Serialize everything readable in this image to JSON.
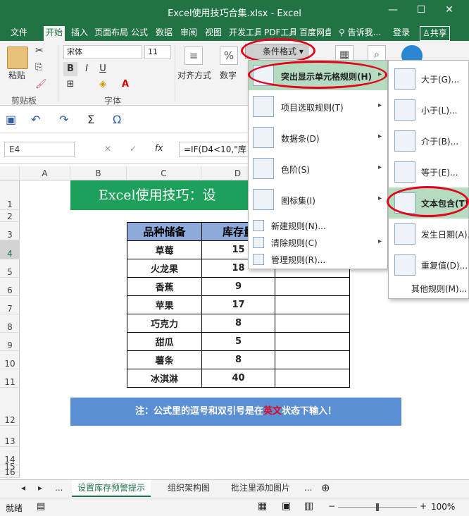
{
  "window": {
    "title": "Excel使用技巧合集.xlsx - Excel",
    "min": "—",
    "max": "☐",
    "close": "✕"
  },
  "tabs": [
    "文件",
    "开始",
    "插入",
    "页面布局",
    "公式",
    "数据",
    "审阅",
    "视图",
    "开发工具",
    "PDF工具",
    "百度网盘",
    "告诉我...",
    "登录",
    "共享"
  ],
  "ribbon": {
    "paste": "粘贴",
    "clipboard": "剪贴板",
    "font_name": "宋体",
    "font_size": "11",
    "font_group": "字体",
    "align": "对齐方式",
    "number": "数字",
    "percent": "%",
    "cond_format": "条件格式"
  },
  "qat": {
    "save": "保存",
    "undo": "撤销",
    "redo": "恢复",
    "sigma": "Σ",
    "omega": "Ω"
  },
  "formula_bar": {
    "name_box": "E4",
    "cancel": "✕",
    "enter": "✓",
    "fx": "fx",
    "formula": "=IF(D4<10,\"库"
  },
  "grid": {
    "columns": [
      "A",
      "B",
      "C",
      "D"
    ],
    "rows": [
      "1",
      "2",
      "3",
      "4",
      "5",
      "6",
      "7",
      "8",
      "9",
      "10",
      "11",
      "12",
      "13",
      "14",
      "15",
      "16"
    ]
  },
  "sheet": {
    "banner": "Excel使用技巧：设",
    "headers": [
      "品种储备",
      "库存量"
    ],
    "rows": [
      [
        "草莓",
        "15"
      ],
      [
        "火龙果",
        "18"
      ],
      [
        "香蕉",
        "9"
      ],
      [
        "苹果",
        "17"
      ],
      [
        "巧克力",
        "8"
      ],
      [
        "甜瓜",
        "5"
      ],
      [
        "薯条",
        "8"
      ],
      [
        "冰淇淋",
        "40"
      ]
    ],
    "note_pre": "注：公式里的逗号和双引号是在",
    "note_red": "英文",
    "note_post": "状态下输入！"
  },
  "menu_main": [
    {
      "label": "突出显示单元格规则(H)",
      "arrow": "▸"
    },
    {
      "label": "项目选取规则(T)",
      "arrow": "▸"
    },
    {
      "label": "数据条(D)",
      "arrow": "▸"
    },
    {
      "label": "色阶(S)",
      "arrow": "▸"
    },
    {
      "label": "图标集(I)",
      "arrow": "▸"
    },
    {
      "label": "新建规则(N)..."
    },
    {
      "label": "清除规则(C)",
      "arrow": "▸"
    },
    {
      "label": "管理规则(R)..."
    }
  ],
  "menu_sub": [
    {
      "label": "大于(G)..."
    },
    {
      "label": "小于(L)..."
    },
    {
      "label": "介于(B)..."
    },
    {
      "label": "等于(E)..."
    },
    {
      "label": "文本包含(T)..."
    },
    {
      "label": "发生日期(A)..."
    },
    {
      "label": "重复值(D)..."
    },
    {
      "label": "其他规则(M)..."
    }
  ],
  "sheet_tabs": [
    "...",
    "设置库存预警提示",
    "组织架构图",
    "批注里添加图片",
    "..."
  ],
  "status": {
    "ready": "就绪",
    "zoom": "100%"
  },
  "colors": {
    "excel_green": "#217346",
    "banner": "#1da15a",
    "header_fill": "#8eaadb",
    "note_fill": "#5b8fd4",
    "highlight": "#b5dcc1",
    "ring": "#e3001b"
  }
}
